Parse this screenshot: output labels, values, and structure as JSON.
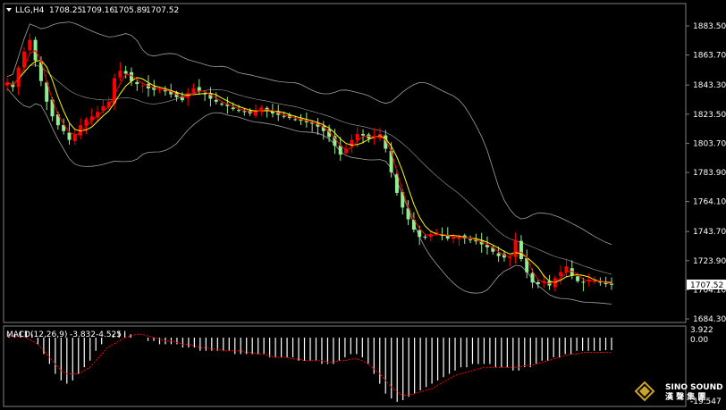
{
  "header": {
    "symbol_period": "LLG,H4",
    "open": "1708.25",
    "high": "1709.16",
    "low": "1705.89",
    "close": "1707.52"
  },
  "macd": {
    "label": "MACD(12,26,9)",
    "main_value": "-3.832",
    "signal_value": "-4.525",
    "axis_top": "3.922",
    "axis_zero": "0.00",
    "axis_bottom": "-19.547",
    "colors": {
      "histogram": "#ffffff",
      "signal": "#ff0000"
    }
  },
  "price_axis": {
    "tick_labels": [
      "1883.50",
      "1863.70",
      "1843.30",
      "1823.50",
      "1803.70",
      "1783.90",
      "1764.10",
      "1743.70",
      "1723.90",
      "1704.10",
      "1684.30"
    ],
    "current_price": "1707.52"
  },
  "watermark": {
    "brand": "SINO SOUND",
    "brand_cn": "漢 聲 集 團"
  },
  "chart_data": {
    "type": "candlestick",
    "ylim": [
      1684.3,
      1890.0
    ],
    "colors": {
      "up": "#ff0000",
      "down": "#90ee90",
      "ma_fast": "#ffff00",
      "ma_mid": "#ff0000",
      "bollinger": "#a0a0a0"
    },
    "close_path": [
      1845,
      1842,
      1855,
      1866,
      1874,
      1860,
      1846,
      1832,
      1822,
      1816,
      1812,
      1806,
      1810,
      1816,
      1820,
      1822,
      1825,
      1829,
      1832,
      1848,
      1853,
      1851,
      1846,
      1844,
      1843,
      1841,
      1840,
      1841,
      1839,
      1837,
      1835,
      1833,
      1838,
      1841,
      1839,
      1837,
      1834,
      1832,
      1830,
      1829,
      1827,
      1826,
      1825,
      1824,
      1826,
      1828,
      1826,
      1824,
      1823,
      1822,
      1821,
      1820,
      1819,
      1818,
      1817,
      1815,
      1812,
      1808,
      1802,
      1796,
      1800,
      1806,
      1810,
      1809,
      1807,
      1808,
      1810,
      1800,
      1784,
      1770,
      1760,
      1752,
      1745,
      1740,
      1740,
      1742,
      1743,
      1741,
      1739,
      1740,
      1740,
      1739,
      1738,
      1737,
      1735,
      1733,
      1730,
      1727,
      1726,
      1726,
      1738,
      1725,
      1716,
      1709,
      1708,
      1710,
      1707,
      1712,
      1716,
      1720,
      1714,
      1710,
      1709,
      1711,
      1710,
      1709,
      1708,
      1707.5
    ],
    "macd_histogram_path": [
      1,
      1,
      2,
      2,
      1,
      -2,
      -5,
      -8,
      -11,
      -13,
      -14,
      -13,
      -11,
      -9,
      -7,
      -4,
      -2,
      0,
      1,
      2,
      2,
      1,
      0,
      0,
      -1,
      -1,
      -2,
      -2,
      -2,
      -2,
      -3,
      -3,
      -3,
      -4,
      -4,
      -4,
      -4,
      -4,
      -4,
      -5,
      -5,
      -5,
      -5,
      -5,
      -5,
      -6,
      -6,
      -6,
      -6,
      -6,
      -7,
      -7,
      -7,
      -7,
      -8,
      -8,
      -8,
      -7,
      -6,
      -5,
      -5,
      -6,
      -8,
      -11,
      -14,
      -17,
      -18.5,
      -19.5,
      -19,
      -18,
      -17,
      -16,
      -15,
      -14,
      -13,
      -12,
      -11,
      -10,
      -9,
      -9,
      -8,
      -8,
      -8,
      -8,
      -9,
      -9,
      -9,
      -10,
      -10,
      -9,
      -9,
      -8,
      -7,
      -7,
      -6,
      -6,
      -5,
      -5,
      -4,
      -4,
      -4,
      -4,
      -4,
      -3.8,
      -3.8
    ],
    "macd_signal_path": [
      0.5,
      0.5,
      0.5,
      0,
      -1,
      -2,
      -4,
      -6,
      -8,
      -10,
      -11,
      -11,
      -11,
      -10,
      -9,
      -7,
      -5,
      -3,
      -2,
      -1,
      0,
      0.5,
      1,
      1,
      0.5,
      0,
      -0.5,
      -1,
      -1,
      -1.5,
      -2,
      -2,
      -2.5,
      -3,
      -3,
      -3.5,
      -3.5,
      -4,
      -4,
      -4,
      -4,
      -4.5,
      -4.5,
      -5,
      -5,
      -5.5,
      -6,
      -6,
      -6,
      -6.5,
      -6.5,
      -7,
      -7,
      -7,
      -7,
      -7.5,
      -7.5,
      -7,
      -7,
      -6.5,
      -6.5,
      -7,
      -8,
      -9.5,
      -11,
      -13,
      -15,
      -16.5,
      -17.5,
      -17.5,
      -17,
      -16.5,
      -16,
      -15.5,
      -14.5,
      -13.5,
      -12.5,
      -11.5,
      -11,
      -10.5,
      -10,
      -9.5,
      -9,
      -9,
      -9,
      -9,
      -9,
      -9,
      -9,
      -8.5,
      -8.5,
      -8,
      -7.5,
      -7,
      -6.5,
      -6,
      -5.5,
      -5,
      -5,
      -4.5,
      -4.5,
      -4.5,
      -4.5,
      -4.5,
      -4.5
    ]
  }
}
